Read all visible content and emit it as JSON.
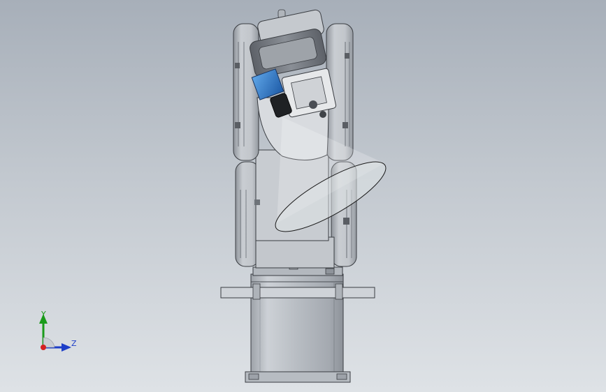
{
  "viewport": {
    "background_top": "#a7afb9",
    "background_bottom": "#dee2e6"
  },
  "model": {
    "parts": [
      "robot-base",
      "base-flange",
      "lower-arm",
      "upper-arm",
      "wrist",
      "camera"
    ],
    "body_color": "#c2c7cd",
    "camera_color": "#2f78c8"
  },
  "triad": {
    "y_label": "Y",
    "z_label": "Z",
    "y_color": "#1a9b1a",
    "z_color": "#1e3fc8",
    "origin_color": "#d42020"
  }
}
